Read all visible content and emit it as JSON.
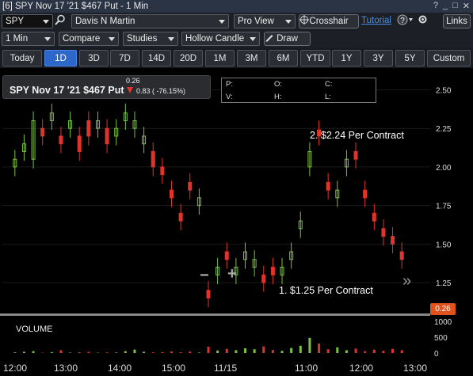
{
  "window": {
    "title": "[6] SPY Nov 17 '21 $467 Put - 1 Min",
    "controls": [
      "?",
      "_",
      "□",
      "✕"
    ]
  },
  "toolbar1": {
    "symbol": "SPY",
    "account": "Davis N Martin",
    "view": "Pro View",
    "crosshair": "Crosshair",
    "tutorial": "Tutorial",
    "help": "?",
    "links": "Links"
  },
  "toolbar2": {
    "interval": "1 Min",
    "compare": "Compare",
    "studies": "Studies",
    "chart_style": "Hollow Candle",
    "draw": "Draw"
  },
  "ranges": [
    "Today",
    "1D",
    "3D",
    "7D",
    "14D",
    "20D",
    "1M",
    "3M",
    "6M",
    "YTD",
    "1Y",
    "3Y",
    "5Y",
    "Custom"
  ],
  "active_range": "1D",
  "info": {
    "symbol_line": "SPY Nov 17 '21 $467 Put",
    "last": "0.26",
    "change": "0.83 ( -76.15%)"
  },
  "ohlc": {
    "p": "P:",
    "o": "O:",
    "c": "C:",
    "v": "V:",
    "h": "H:",
    "l": "L:"
  },
  "annotations": {
    "a1": "1. $1.25 Per Contract",
    "a2": "2. $2.24 Per Contract"
  },
  "last_price_tag": "0.26",
  "volume_label": "VOLUME",
  "colors": {
    "up": "#7bc043",
    "down": "#e0342a",
    "accent": "#2d67c9",
    "tag": "#e0531f"
  },
  "chart_data": {
    "type": "candlestick",
    "ylim": [
      1.05,
      2.6
    ],
    "price_ticks": [
      "2.50",
      "2.25",
      "2.00",
      "1.75",
      "1.50",
      "1.25"
    ],
    "volume_ticks": [
      "1000",
      "500",
      "0"
    ],
    "time_ticks": [
      "12:00",
      "13:00",
      "14:00",
      "15:00",
      "11/15",
      "11:00",
      "12:00",
      "13:00"
    ],
    "price_series": [
      [
        2.0,
        2.05
      ],
      [
        2.1,
        2.15
      ],
      [
        2.05,
        2.3
      ],
      [
        2.25,
        2.2
      ],
      [
        2.3,
        2.35
      ],
      [
        2.2,
        2.15
      ],
      [
        2.25,
        2.3
      ],
      [
        2.2,
        2.1
      ],
      [
        2.3,
        2.2
      ],
      [
        2.25,
        2.3
      ],
      [
        2.25,
        2.15
      ],
      [
        2.2,
        2.25
      ],
      [
        2.3,
        2.35
      ],
      [
        2.25,
        2.3
      ],
      [
        2.15,
        2.2
      ],
      [
        2.1,
        2.0
      ],
      [
        2.0,
        1.95
      ],
      [
        1.85,
        1.8
      ],
      [
        1.7,
        1.65
      ],
      [
        1.9,
        1.85
      ],
      [
        1.75,
        1.8
      ],
      [
        1.2,
        1.15
      ],
      [
        1.3,
        1.35
      ],
      [
        1.45,
        1.4
      ],
      [
        1.3,
        1.35
      ],
      [
        1.4,
        1.45
      ],
      [
        1.35,
        1.4
      ],
      [
        1.3,
        1.25
      ],
      [
        1.35,
        1.3
      ],
      [
        1.3,
        1.35
      ],
      [
        1.4,
        1.45
      ],
      [
        1.6,
        1.65
      ],
      [
        2.0,
        2.1
      ],
      [
        2.24,
        2.2
      ],
      [
        1.9,
        1.85
      ],
      [
        1.8,
        1.85
      ],
      [
        2.0,
        2.05
      ],
      [
        2.1,
        2.05
      ],
      [
        1.85,
        1.8
      ],
      [
        1.7,
        1.65
      ],
      [
        1.6,
        1.55
      ],
      [
        1.55,
        1.5
      ],
      [
        1.45,
        1.4
      ]
    ],
    "volume": [
      20,
      40,
      60,
      10,
      30,
      90,
      15,
      25,
      35,
      10,
      20,
      15,
      60,
      110,
      40,
      20,
      30,
      50,
      25,
      45,
      15,
      200,
      80,
      130,
      90,
      150,
      120,
      210,
      95,
      70,
      160,
      230,
      480,
      300,
      120,
      180,
      90,
      140,
      60,
      110,
      70,
      130,
      90
    ]
  }
}
